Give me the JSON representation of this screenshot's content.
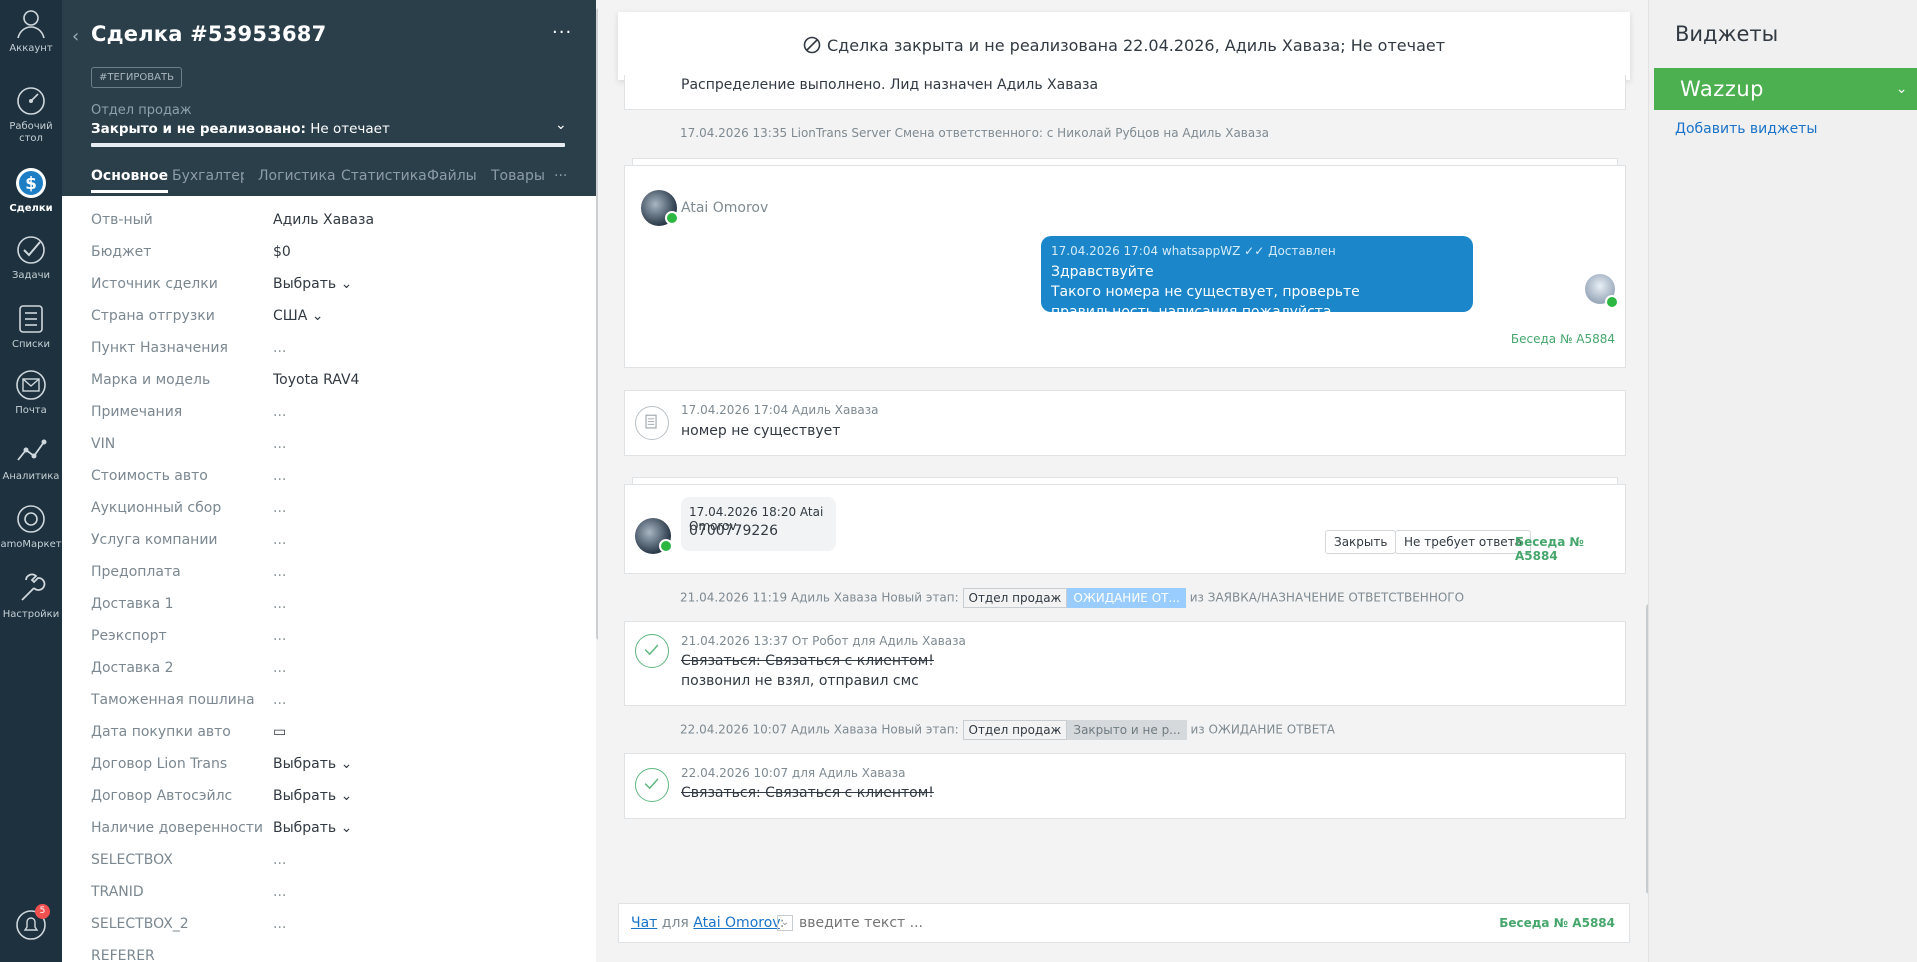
{
  "nav": [
    {
      "label": "Аккаунт",
      "icon": "account-icon"
    },
    {
      "label": "Рабочий стол",
      "icon": "dashboard-icon"
    },
    {
      "label": "Сделки",
      "icon": "deals-icon"
    },
    {
      "label": "Задачи",
      "icon": "tasks-icon"
    },
    {
      "label": "Списки",
      "icon": "lists-icon"
    },
    {
      "label": "Почта",
      "icon": "mail-icon"
    },
    {
      "label": "Аналитика",
      "icon": "analytics-icon"
    },
    {
      "label": "amoМаркет",
      "icon": "market-icon"
    },
    {
      "label": "Настройки",
      "icon": "settings-icon"
    }
  ],
  "notifications_count": "5",
  "card": {
    "title": "Сделка #53953687",
    "more": "···",
    "tag_button": "#ТЕГИРОВАТЬ",
    "pipeline": "Отдел продаж",
    "status_prefix": "Закрыто и не реализовано:",
    "status_reason": " Не отечает",
    "tabs": [
      "Основное",
      "Бухгалтерия",
      "Логистика",
      "Статистика",
      "Файлы",
      "Товары",
      "···"
    ],
    "tab_labels_visible": [
      "Основное",
      "Бухгалтер",
      "Логистика",
      "Статистика",
      "Файлы",
      "Товары",
      "···"
    ],
    "fields": [
      {
        "label": "Отв-ный",
        "value": "Адиль Хаваза"
      },
      {
        "label": "Бюджет",
        "value": "$0"
      },
      {
        "label": "Источник сделки",
        "value": "Выбрать ⌄"
      },
      {
        "label": "Страна отгрузки",
        "value": "США ⌄"
      },
      {
        "label": "Пункт Назначения",
        "value": "..."
      },
      {
        "label": "Марка и модель",
        "value": "Toyota RAV4"
      },
      {
        "label": "Примечания",
        "value": "..."
      },
      {
        "label": "VIN",
        "value": "..."
      },
      {
        "label": "Стоимость авто",
        "value": "..."
      },
      {
        "label": "Аукционный сбор",
        "value": "..."
      },
      {
        "label": "Услуга компании",
        "value": "..."
      },
      {
        "label": "Предоплата",
        "value": "..."
      },
      {
        "label": "Доставка 1",
        "value": "..."
      },
      {
        "label": "Реэкспорт",
        "value": "..."
      },
      {
        "label": "Доставка 2",
        "value": "..."
      },
      {
        "label": "Таможенная пошлина",
        "value": "..."
      },
      {
        "label": "Дата покупки авто",
        "value": "▭"
      },
      {
        "label": "Договор Lion Trans",
        "value": "Выбрать ⌄"
      },
      {
        "label": "Договор Автосэйлс",
        "value": "Выбрать ⌄"
      },
      {
        "label": "Наличие доверенности",
        "value": "Выбрать ⌄"
      },
      {
        "label": "SELECTBOX",
        "value": "..."
      },
      {
        "label": "TRANID",
        "value": "..."
      },
      {
        "label": "SELECTBOX_2",
        "value": "..."
      },
      {
        "label": "REFERER",
        "value": ""
      }
    ]
  },
  "feed": {
    "banner": "Сделка закрыта и не реализована 22.04.2026, Адиль Хаваза; Не отечает",
    "top_text": "Распределение выполнено. Лид назначен Адиль Хаваза",
    "system_note_1": "17.04.2026 13:35 LionTrans Server Смена ответственного: с Николай Рубцов на Адиль Хаваза",
    "chat1": {
      "contact_name": "Atai Omorov",
      "bubble_meta": "17.04.2026 17:04 whatsappWZ",
      "bubble_status": "✓✓ Доставлен",
      "bubble_line1": "Здравствуйте",
      "bubble_line2": "Такого номера не существует, проверьте правильность написания пожалуйста",
      "talk_link": "Беседа № А5884"
    },
    "note": {
      "meta": "17.04.2026 17:04 Адиль Хаваза",
      "text": "номер не существует"
    },
    "chat2": {
      "meta": "17.04.2026 18:20 Atai Omorov",
      "text": "0700779226",
      "close_btn": "Закрыть",
      "no_reply_btn": "Не требует ответа",
      "talk_link": "Беседа № А5884"
    },
    "stage1": {
      "prefix": "21.04.2026 11:19 Адиль Хаваза Новый этап:",
      "pipeline": "Отдел продаж",
      "stage": "ОЖИДАНИЕ ОТ...",
      "suffix": "из ЗАЯВКА/НАЗНАЧЕНИЕ ОТВЕТСТВЕННОГО"
    },
    "task1": {
      "meta": "21.04.2026 13:37  От Робот для Адиль Хаваза",
      "title": "Связаться: Связаться с клиентом!",
      "result": "позвонил не взял, отправил смс"
    },
    "stage2": {
      "prefix": "22.04.2026 10:07 Адиль Хаваза Новый этап:",
      "pipeline": "Отдел продаж",
      "stage": "Закрыто и не р...",
      "suffix": "из ОЖИДАНИЕ ОТВЕТА"
    },
    "task2": {
      "meta": "22.04.2026 10:07  для Адиль Хаваза",
      "title": "Связаться: Связаться с клиентом!"
    },
    "composer": {
      "chat_link": "Чат",
      "for": " для ",
      "contact": "Atai Omorov",
      "colon": ":",
      "placeholder": "введите текст ...",
      "talk_link": "Беседа № А5884"
    }
  },
  "widgets": {
    "title": "Виджеты",
    "wazzup": "Wazzup",
    "add": "Добавить виджеты"
  },
  "colors": {
    "nav_bg": "#1d323e",
    "card_head_bg": "#2b3f4b",
    "bubble": "#1b86c9",
    "wazzup": "#4caf50",
    "link": "#1a73c8",
    "green_link": "#46a66b"
  }
}
